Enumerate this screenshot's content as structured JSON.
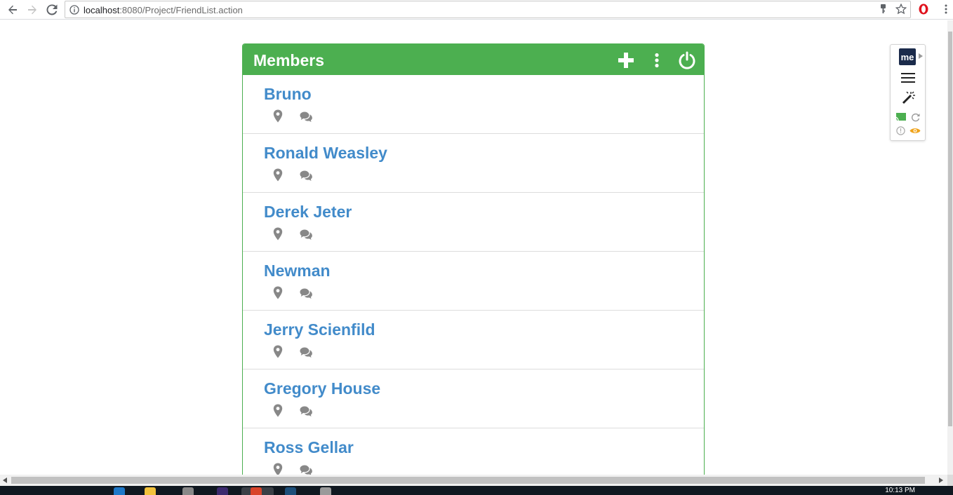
{
  "browser": {
    "url_host": "localhost",
    "url_path": ":8080/Project/FriendList.action",
    "icons": [
      "back-icon",
      "forward-icon",
      "reload-icon",
      "info-icon",
      "key-icon",
      "star-icon",
      "opera-icon",
      "menu-icon"
    ]
  },
  "panel": {
    "title": "Members",
    "header_icons": [
      "plus-icon",
      "more-vertical-icon",
      "power-icon"
    ],
    "accent_color": "#4caf50",
    "name_color": "#428bca"
  },
  "members": [
    {
      "name": "Bruno"
    },
    {
      "name": "Ronald Weasley"
    },
    {
      "name": "Derek Jeter"
    },
    {
      "name": "Newman"
    },
    {
      "name": "Jerry Scienfild"
    },
    {
      "name": "Gregory House"
    },
    {
      "name": "Ross Gellar"
    }
  ],
  "extension": {
    "badge": "me"
  },
  "taskbar": {
    "clock": "10:13 PM"
  }
}
